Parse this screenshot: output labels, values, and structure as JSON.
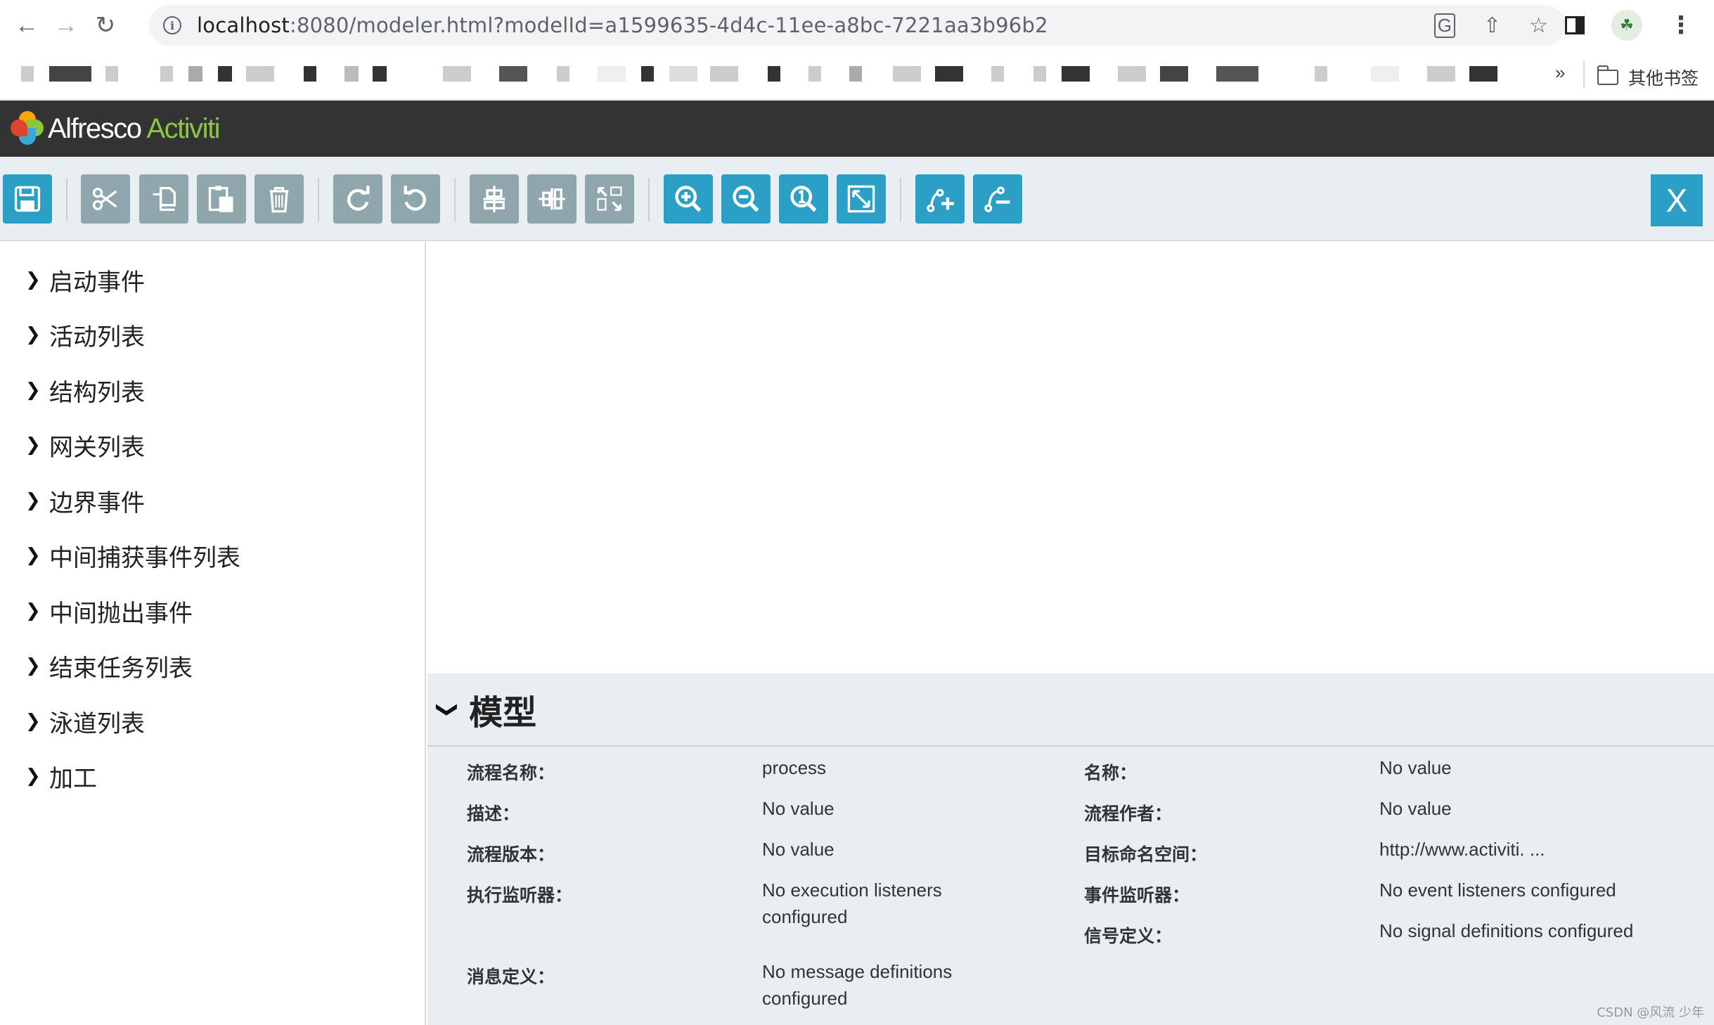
{
  "browser": {
    "url_host": "localhost",
    "url_rest": ":8080/modeler.html?modelId=a1599635-4d4c-11ee-a8bc-7221aa3b96b2",
    "more_bookmarks": "»",
    "bookmarks_folder_label": "其他书签"
  },
  "app": {
    "logo_primary": "Alfresco",
    "logo_secondary": "Activiti"
  },
  "toolbar": {
    "buttons": [
      {
        "name": "save-button",
        "icon": "floppy-disk-icon",
        "style": "blue"
      },
      {
        "name": "cut-button",
        "icon": "scissors-icon",
        "style": "gray"
      },
      {
        "name": "copy-button",
        "icon": "copy-icon",
        "style": "gray"
      },
      {
        "name": "paste-button",
        "icon": "paste-icon",
        "style": "gray"
      },
      {
        "name": "delete-button",
        "icon": "trash-icon",
        "style": "gray"
      },
      {
        "name": "redo-button",
        "icon": "redo-icon",
        "style": "gray"
      },
      {
        "name": "undo-button",
        "icon": "undo-icon",
        "style": "gray"
      },
      {
        "name": "align-vertical-button",
        "icon": "align-vertical-icon",
        "style": "gray"
      },
      {
        "name": "align-horizontal-button",
        "icon": "align-horizontal-icon",
        "style": "gray"
      },
      {
        "name": "same-size-button",
        "icon": "same-size-icon",
        "style": "gray"
      },
      {
        "name": "zoom-in-button",
        "icon": "zoom-in-icon",
        "style": "blue"
      },
      {
        "name": "zoom-out-button",
        "icon": "zoom-out-icon",
        "style": "blue"
      },
      {
        "name": "zoom-actual-button",
        "icon": "zoom-actual-icon",
        "style": "blue"
      },
      {
        "name": "zoom-fit-button",
        "icon": "zoom-fit-icon",
        "style": "blue"
      },
      {
        "name": "add-bendpoint-button",
        "icon": "add-bendpoint-icon",
        "style": "blue"
      },
      {
        "name": "remove-bendpoint-button",
        "icon": "remove-bendpoint-icon",
        "style": "blue"
      }
    ],
    "close_label": "X"
  },
  "palette": {
    "items": [
      {
        "label": "启动事件"
      },
      {
        "label": "活动列表"
      },
      {
        "label": "结构列表"
      },
      {
        "label": "网关列表"
      },
      {
        "label": "边界事件"
      },
      {
        "label": "中间捕获事件列表"
      },
      {
        "label": "中间抛出事件"
      },
      {
        "label": "结束任务列表"
      },
      {
        "label": "泳道列表"
      },
      {
        "label": "加工"
      }
    ]
  },
  "properties": {
    "title": "模型",
    "left": [
      {
        "label": "流程名称：",
        "value": "process"
      },
      {
        "label": "描述：",
        "value": "No value"
      },
      {
        "label": "流程版本：",
        "value": "No value"
      },
      {
        "label": "执行监听器：",
        "value": "No execution listeners configured"
      },
      {
        "label": "消息定义：",
        "value": "No message definitions configured"
      }
    ],
    "right": [
      {
        "label": "名称：",
        "value": "No value"
      },
      {
        "label": "流程作者：",
        "value": "No value"
      },
      {
        "label": "目标命名空间：",
        "value": "http://www.activiti. ..."
      },
      {
        "label": "事件监听器：",
        "value": "No event listeners configured"
      },
      {
        "label": "信号定义：",
        "value": "No signal definitions configured"
      }
    ]
  },
  "watermark": "CSDN @风流 少年",
  "colors": {
    "header_bg": "#333333",
    "toolbar_bg": "#e8eef1",
    "button_blue": "#2b9fc6",
    "button_gray": "#8fa6ac",
    "logo_green": "#8dc63f"
  }
}
